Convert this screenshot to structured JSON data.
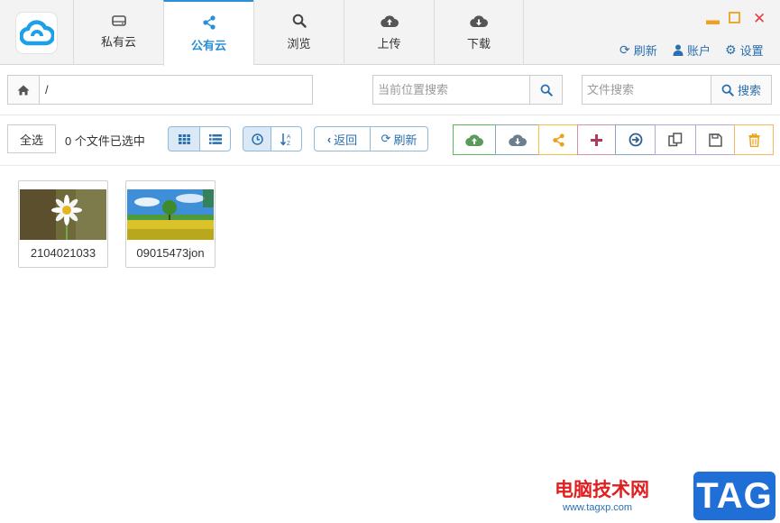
{
  "tabs": [
    {
      "label": "私有云",
      "icon": "drive-icon"
    },
    {
      "label": "公有云",
      "icon": "share-icon"
    },
    {
      "label": "浏览",
      "icon": "search-icon"
    },
    {
      "label": "上传",
      "icon": "cloud-upload-icon"
    },
    {
      "label": "下载",
      "icon": "cloud-download-icon"
    }
  ],
  "active_tab": "公有云",
  "header_actions": {
    "refresh": "刷新",
    "account": "账户",
    "settings": "设置"
  },
  "path": {
    "value": "/",
    "location_search_placeholder": "当前位置搜索",
    "file_search_placeholder": "文件搜索",
    "search_label": "搜索"
  },
  "toolbar": {
    "select_all": "全选",
    "selected_status": "0 个文件已选中",
    "back": "返回",
    "refresh": "刷新"
  },
  "action_colors": {
    "upload": "#5cb85c",
    "download": "#6c8ea8",
    "share": "#e8a317",
    "new": "#b03a5b",
    "move": "#2f6f9f",
    "copy": "#555555",
    "save": "#555555",
    "delete": "#e8a317"
  },
  "files": [
    {
      "name": "2104021033",
      "thumbnail": "daisy-photo"
    },
    {
      "name": "09015473jon",
      "thumbnail": "meadow-tree-photo"
    }
  ],
  "watermark": {
    "site_name": "电脑技术网",
    "url": "www.tagxp.com",
    "badge": "TAG"
  }
}
